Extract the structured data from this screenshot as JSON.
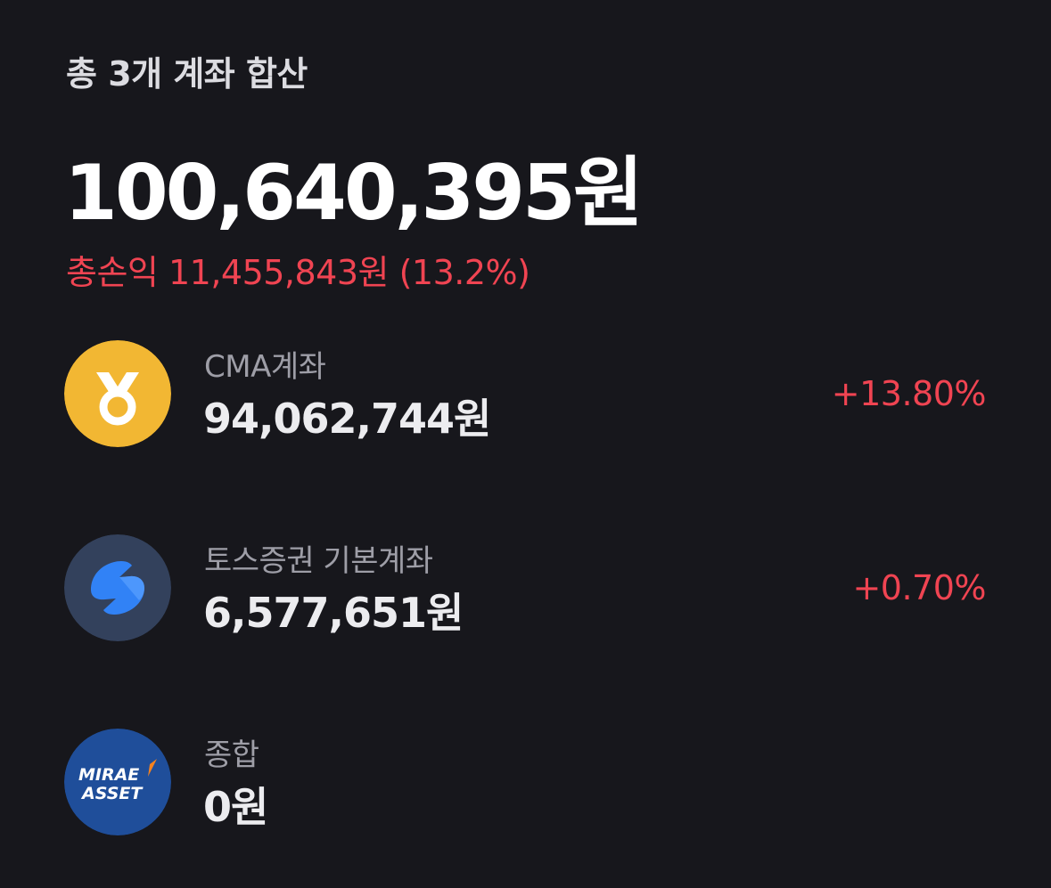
{
  "summary": {
    "label": "총 3개 계좌 합산",
    "total_amount": "100,640,395원",
    "total_profit": "총손익 11,455,843원 (13.2%)"
  },
  "colors": {
    "background": "#17171c",
    "profit_red": "#f04452",
    "cma_logo_bg": "#f2b733",
    "toss_logo_bg": "#33415c",
    "toss_logo_blue": "#3182f6",
    "mirae_logo_bg": "#1f4e9a",
    "mirae_accent": "#f5821f"
  },
  "accounts": [
    {
      "icon": "medal-icon",
      "name": "CMA계좌",
      "balance": "94,062,744원",
      "rate": "+13.80%"
    },
    {
      "icon": "toss-logo-icon",
      "name": "토스증권 기본계좌",
      "balance": "6,577,651원",
      "rate": "+0.70%"
    },
    {
      "icon": "mirae-asset-logo",
      "logo_text": [
        "MIRAE",
        "ASSET"
      ],
      "name": "종합",
      "balance": "0원",
      "rate": ""
    }
  ]
}
